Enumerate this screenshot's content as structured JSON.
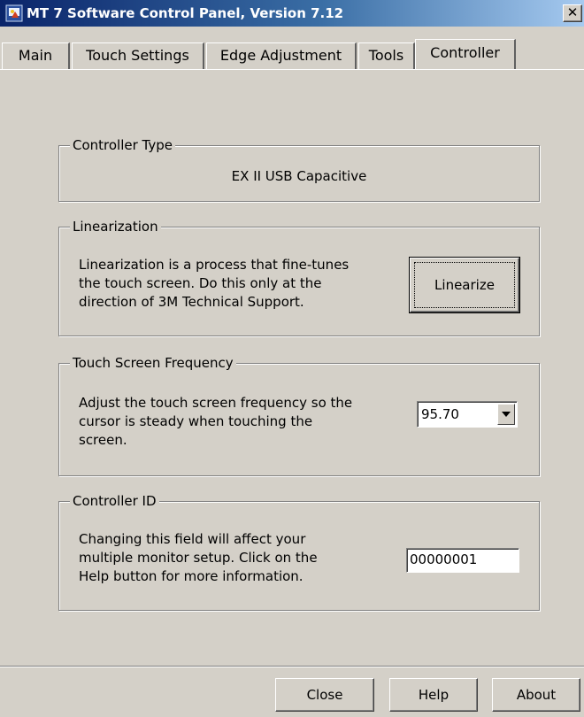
{
  "window": {
    "title": "MT 7 Software Control Panel, Version 7.12",
    "close_glyph": "✕"
  },
  "tabs": [
    {
      "label": "Main"
    },
    {
      "label": "Touch Settings"
    },
    {
      "label": "Edge Adjustment"
    },
    {
      "label": "Tools"
    },
    {
      "label": "Controller",
      "active": true
    }
  ],
  "controller_type": {
    "legend": "Controller Type",
    "value": "EX II USB Capacitive"
  },
  "linearization": {
    "legend": "Linearization",
    "line1": "Linearization is a process that fine-tunes",
    "line2": "the touch screen. Do this only at the",
    "line3": "direction of 3M Technical Support.",
    "button_label": "Linearize"
  },
  "frequency": {
    "legend": "Touch Screen Frequency",
    "line1": "Adjust the touch screen frequency so the",
    "line2": "cursor is steady when touching the",
    "line3": "screen.",
    "selected_value": "95.70"
  },
  "controller_id": {
    "legend": "Controller ID",
    "line1": "Changing this field will affect your",
    "line2": "multiple monitor setup. Click on the",
    "line3": "Help button for more information.",
    "value": "00000001"
  },
  "footer": {
    "close_label": "Close",
    "help_label": "Help",
    "about_label": "About"
  },
  "icons": {
    "app": "app-icon",
    "dropdown": "chevron-down-icon"
  },
  "colors": {
    "face": "#d4d0c8",
    "title_start": "#0a246a",
    "title_end": "#a6caf0"
  }
}
